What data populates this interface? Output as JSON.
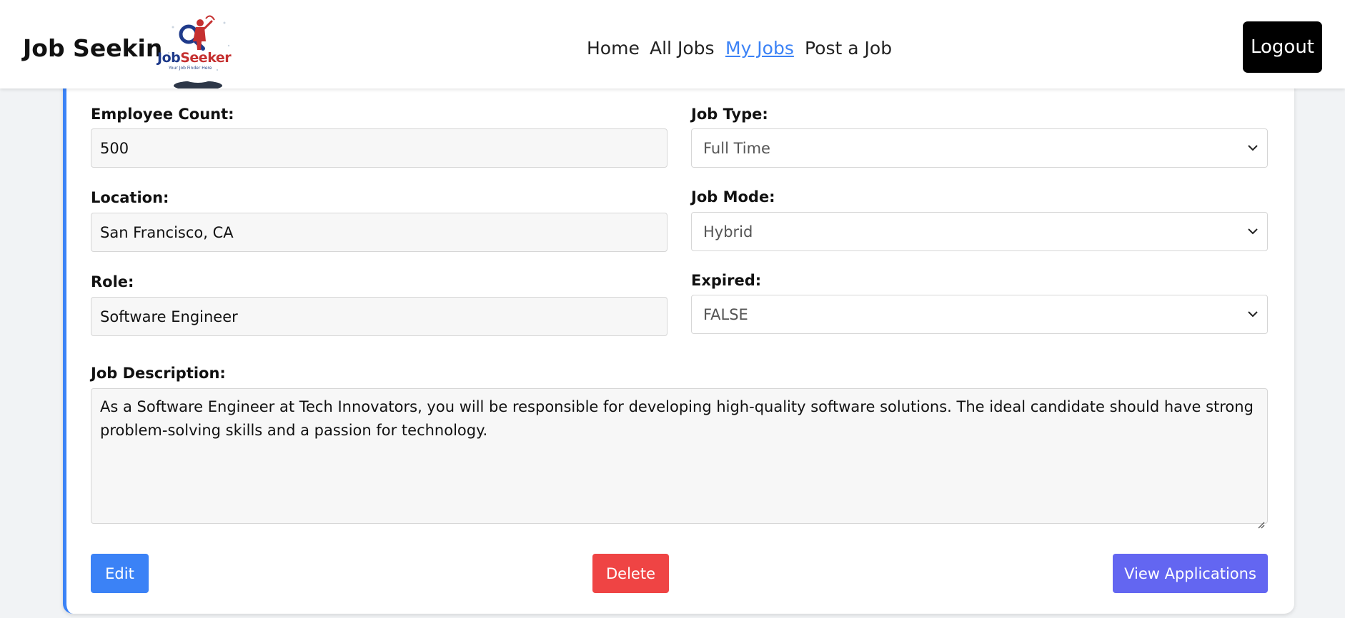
{
  "header": {
    "brand": "Job Seeking",
    "logo_text": "JobSeeker",
    "logo_tagline": "Your Job Finder Here",
    "nav": [
      {
        "label": "Home",
        "active": false
      },
      {
        "label": "All Jobs",
        "active": false
      },
      {
        "label": "My Jobs",
        "active": true
      },
      {
        "label": "Post a Job",
        "active": false
      }
    ],
    "logout_label": "Logout"
  },
  "form": {
    "employee_count": {
      "label": "Employee Count:",
      "value": "500"
    },
    "location": {
      "label": "Location:",
      "value": "San Francisco, CA"
    },
    "role": {
      "label": "Role:",
      "value": "Software Engineer"
    },
    "job_type": {
      "label": "Job Type:",
      "value": "Full Time"
    },
    "job_mode": {
      "label": "Job Mode:",
      "value": "Hybrid"
    },
    "expired": {
      "label": "Expired:",
      "value": "FALSE"
    },
    "description": {
      "label": "Job Description:",
      "value": "As a Software Engineer at Tech Innovators, you will be responsible for developing high-quality software solutions. The ideal candidate should have strong problem-solving skills and a passion for technology."
    }
  },
  "actions": {
    "edit_label": "Edit",
    "delete_label": "Delete",
    "view_applications_label": "View Applications"
  },
  "colors": {
    "accent": "#3b82f6",
    "edit": "#3b82f6",
    "delete": "#ef4444",
    "view_applications": "#6366f1",
    "logout": "#000000"
  },
  "icons": {
    "select_chevron": "chevron-down-icon",
    "resize_grip": "resize-handle-icon"
  }
}
